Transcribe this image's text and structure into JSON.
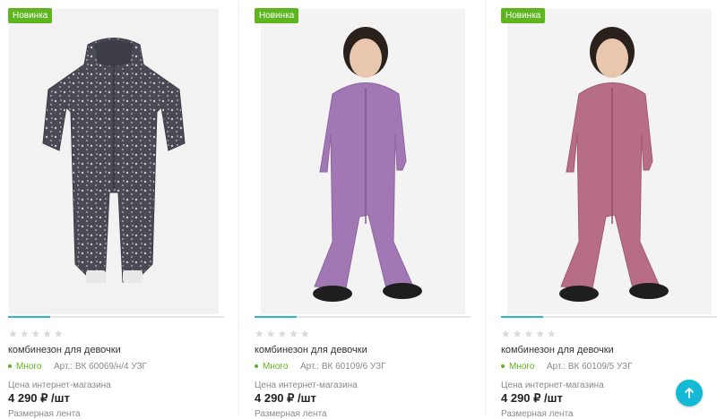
{
  "products": [
    {
      "badge": "Новинка",
      "rating_stars": "★★★★★",
      "title": "комбинезон для девочки",
      "availability": "Много",
      "article": "Арт.: ВК 60069/н/4 УЗГ",
      "price_label": "Цена интернет-магазина",
      "price": "4 290 ₽ /шт",
      "extra_line": "Размерная лента",
      "garment_color": "#4a4a55"
    },
    {
      "badge": "Новинка",
      "rating_stars": "★★★★★",
      "title": "комбинезон для девочки",
      "availability": "Много",
      "article": "Арт.: ВК 60109/6 УЗГ",
      "price_label": "Цена интернет-магазина",
      "price": "4 290 ₽ /шт",
      "extra_line": "Размерная лента",
      "garment_color": "#a178b4"
    },
    {
      "badge": "Новинка",
      "rating_stars": "★★★★★",
      "title": "комбинезон для девочки",
      "availability": "Много",
      "article": "Арт.: ВК 60109/5 УЗГ",
      "price_label": "Цена интернет-магазина",
      "price": "4 290 ₽ /шт",
      "extra_line": "Размерная лента",
      "garment_color": "#b86d86"
    }
  ],
  "colors": {
    "badge_bg": "#5eb51f",
    "accent": "#14b9d5",
    "stock": "#5eb51f"
  },
  "scroll_top_icon": "arrow-up-icon"
}
